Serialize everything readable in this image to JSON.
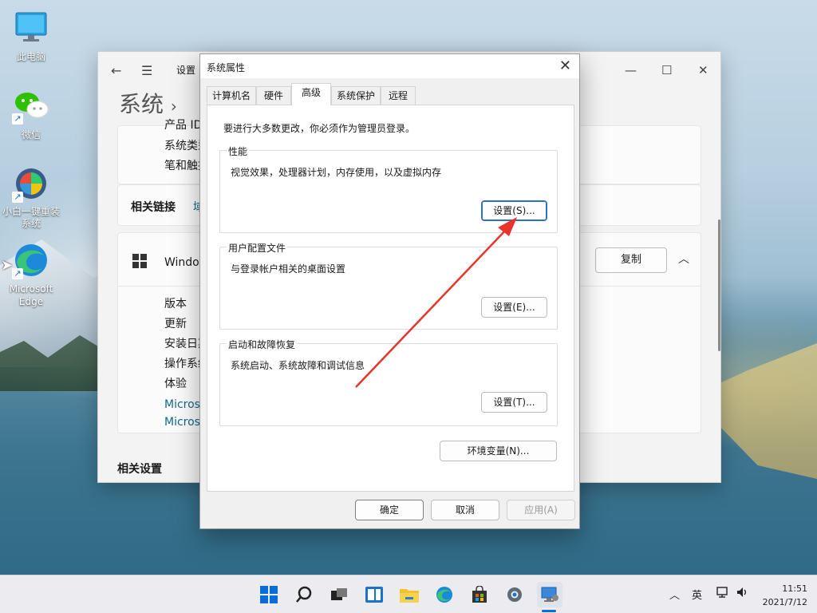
{
  "desktop": {
    "icons": [
      {
        "label": "此电脑",
        "icon": "computer-icon"
      },
      {
        "label": "微信",
        "icon": "wechat-icon"
      },
      {
        "label": "小白一键重装系统",
        "icon": "xiaobai-reinstall-icon"
      },
      {
        "label": "Microsoft Edge",
        "icon": "edge-icon"
      }
    ]
  },
  "settings": {
    "title": "设置",
    "page": "系统",
    "rows_top": [
      "产品 ID",
      "系统类型",
      "笔和触控"
    ],
    "related_links_label": "相关链接",
    "related_links_first": "域",
    "windows_spec_label": "Windows 规格",
    "copy_button": "复制",
    "spec_rows": [
      "版本",
      "更新",
      "安装日期",
      "操作系统版本",
      "体验"
    ],
    "ms_links": [
      "Microsoft 服务协议",
      "Microsoft 软件许可条款"
    ],
    "related_settings": "相关设置"
  },
  "dialog": {
    "title": "系统属性",
    "tabs": [
      "计算机名",
      "硬件",
      "高级",
      "系统保护",
      "远程"
    ],
    "active_tab": "高级",
    "admin_note": "要进行大多数更改，你必须作为管理员登录。",
    "groups": [
      {
        "legend": "性能",
        "desc": "视觉效果，处理器计划，内存使用，以及虚拟内存",
        "button": "设置(S)..."
      },
      {
        "legend": "用户配置文件",
        "desc": "与登录帐户相关的桌面设置",
        "button": "设置(E)..."
      },
      {
        "legend": "启动和故障恢复",
        "desc": "系统启动、系统故障和调试信息",
        "button": "设置(T)..."
      }
    ],
    "env_button": "环境变量(N)...",
    "ok": "确定",
    "cancel": "取消",
    "apply": "应用(A)"
  },
  "taskbar": {
    "icons": [
      "windows-start-icon",
      "search-icon",
      "task-view-icon",
      "widgets-icon",
      "file-explorer-icon",
      "edge-icon",
      "store-icon",
      "settings-gear-icon",
      "system-properties-icon"
    ],
    "ime": "英",
    "time": "11:51",
    "date": "2021/7/12"
  },
  "colors": {
    "accent": "#0067c0",
    "arrow": "#e8342a",
    "link": "#0e6a8a"
  }
}
